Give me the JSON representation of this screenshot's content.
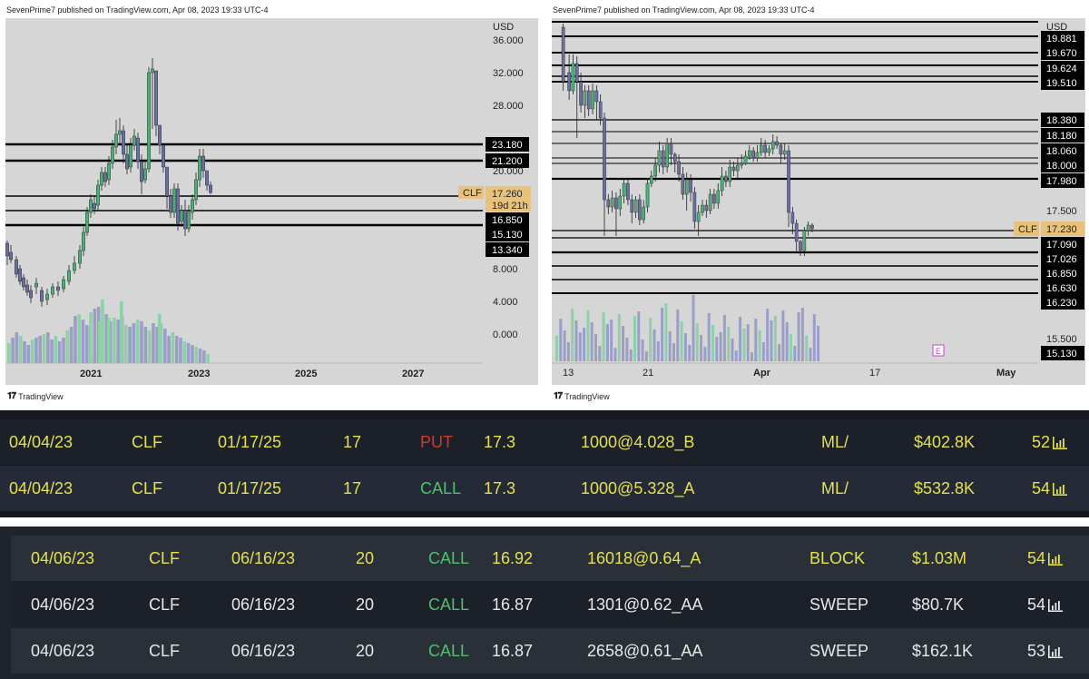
{
  "left_chart": {
    "attribution": "SevenPrime7 published on TradingView.com, Apr 08, 2023 19:33 UTC-4",
    "currency": "USD",
    "symbol": "CLF",
    "last_price": "17.260",
    "countdown": "19d 21h",
    "price_ticks": [
      "36.000",
      "32.000",
      "28.000",
      "20.000",
      "8.000",
      "4.000",
      "0.000"
    ],
    "levels": [
      "23.180",
      "21.200",
      "16.850",
      "15.130",
      "13.340"
    ],
    "time_ticks": [
      "2021",
      "2023",
      "2025",
      "2027"
    ],
    "brand": "TradingView",
    "colors": {
      "up": "#4caf78",
      "down": "#6a6fa0",
      "vol_up": "#8fd1a6",
      "vol_down": "#9a9ec9",
      "price_tag": "#e8c27a"
    }
  },
  "right_chart": {
    "attribution": "SevenPrime7 published on TradingView.com, Apr 08, 2023 19:33 UTC-4",
    "currency": "USD",
    "symbol": "CLF",
    "last_price": "17.230",
    "price_ticks": [
      "17.500",
      "15.500"
    ],
    "levels": [
      "19.881",
      "19.670",
      "19.624",
      "19.510",
      "18.380",
      "18.180",
      "18.060",
      "18.000",
      "17.980",
      "17.090",
      "17.026",
      "16.850",
      "16.630",
      "16.230",
      "15.130"
    ],
    "time_ticks": [
      "13",
      "21",
      "Apr",
      "17",
      "May"
    ],
    "earnings_marker": "E",
    "brand": "TradingView"
  },
  "flow_top": {
    "rows": [
      {
        "date": "04/04/23",
        "ticker": "CLF",
        "expiry": "01/17/25",
        "strike": "17",
        "type": "PUT",
        "spot": "17.3",
        "fill": "1000@4.028_B",
        "kind": "ML/",
        "premium": "$402.8K",
        "score": "52"
      },
      {
        "date": "04/04/23",
        "ticker": "CLF",
        "expiry": "01/17/25",
        "strike": "17",
        "type": "CALL",
        "spot": "17.3",
        "fill": "1000@5.328_A",
        "kind": "ML/",
        "premium": "$532.8K",
        "score": "54"
      }
    ]
  },
  "flow_bottom": {
    "rows": [
      {
        "date": "04/06/23",
        "ticker": "CLF",
        "expiry": "06/16/23",
        "strike": "20",
        "type": "CALL",
        "spot": "16.92",
        "fill": "16018@0.64_A",
        "kind": "BLOCK",
        "premium": "$1.03M",
        "score": "54"
      },
      {
        "date": "04/06/23",
        "ticker": "CLF",
        "expiry": "06/16/23",
        "strike": "20",
        "type": "CALL",
        "spot": "16.87",
        "fill": "1301@0.62_AA",
        "kind": "SWEEP",
        "premium": "$80.7K",
        "score": "54"
      },
      {
        "date": "04/06/23",
        "ticker": "CLF",
        "expiry": "06/16/23",
        "strike": "20",
        "type": "CALL",
        "spot": "16.87",
        "fill": "2658@0.61_AA",
        "kind": "SWEEP",
        "premium": "$162.1K",
        "score": "53"
      }
    ]
  },
  "colors": {
    "yellow": "#e6e04a",
    "white": "#e8e8e8",
    "put": "#d9352b",
    "call": "#4fc06f"
  }
}
